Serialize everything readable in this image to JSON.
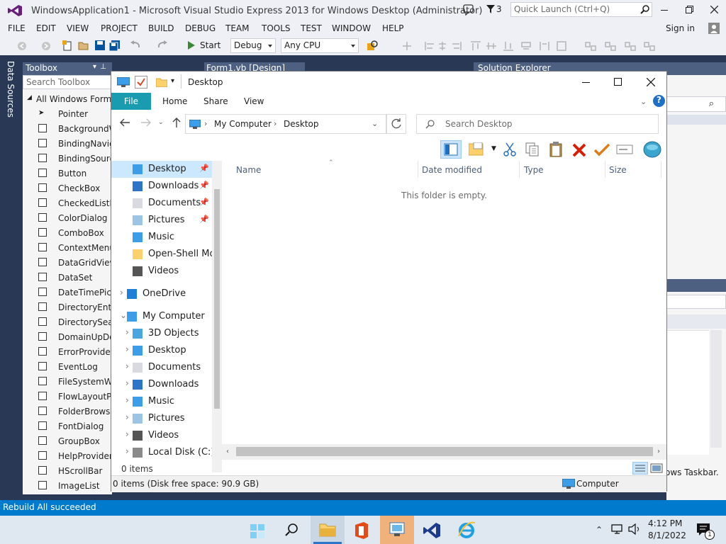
{
  "vs": {
    "title": "WindowsApplication1 - Microsoft Visual Studio Express 2013 for Windows Desktop (Administrator)",
    "notif_count": "3",
    "quick_launch_placeholder": "Quick Launch (Ctrl+Q)",
    "sign_in": "Sign in",
    "menu": [
      "FILE",
      "EDIT",
      "VIEW",
      "PROJECT",
      "BUILD",
      "DEBUG",
      "TEAM",
      "TOOLS",
      "TEST",
      "WINDOW",
      "HELP"
    ],
    "toolbar": {
      "start": "Start",
      "config": "Debug",
      "platform": "Any CPU"
    },
    "data_sources": "Data Sources",
    "toolbox": {
      "title": "Toolbox",
      "search_placeholder": "Search Toolbox",
      "group": "All Windows Forms",
      "items": [
        "Pointer",
        "BackgroundWorker",
        "BindingNavigator",
        "BindingSource",
        "Button",
        "CheckBox",
        "CheckedListBox",
        "ColorDialog",
        "ComboBox",
        "ContextMenuStrip",
        "DataGridView",
        "DataSet",
        "DateTimePicker",
        "DirectoryEntry",
        "DirectorySearcher",
        "DomainUpDown",
        "ErrorProvider",
        "EventLog",
        "FileSystemWatcher",
        "FlowLayoutPanel",
        "FolderBrowserDialog",
        "FontDialog",
        "GroupBox",
        "HelpProvider",
        "HScrollBar",
        "ImageList"
      ]
    },
    "doc_tab": "Form1.vb [Design]",
    "solution_explorer": "Solution Explorer",
    "partial_text": "ows Taskbar.",
    "status": "Rebuild All succeeded"
  },
  "explorer": {
    "title": "Desktop",
    "ribbon_tabs": [
      "File",
      "Home",
      "Share",
      "View"
    ],
    "breadcrumb": [
      "My Computer",
      "Desktop"
    ],
    "search_placeholder": "Search Desktop",
    "quick_access": [
      {
        "label": "Desktop",
        "pinned": true
      },
      {
        "label": "Downloads",
        "pinned": true
      },
      {
        "label": "Documents",
        "pinned": true
      },
      {
        "label": "Pictures",
        "pinned": true
      },
      {
        "label": "Music",
        "pinned": false
      },
      {
        "label": "Open-Shell Mod",
        "pinned": false
      },
      {
        "label": "Videos",
        "pinned": false
      }
    ],
    "onedrive": "OneDrive",
    "my_computer": "My Computer",
    "computer_children": [
      "3D Objects",
      "Desktop",
      "Documents",
      "Downloads",
      "Music",
      "Pictures",
      "Videos",
      "Local Disk (C:)"
    ],
    "columns": [
      "Name",
      "Date modified",
      "Type",
      "Size"
    ],
    "empty_msg": "This folder is empty.",
    "item_count": "0 items",
    "status": "0 items (Disk free space: 90.9 GB)",
    "location": "Computer"
  },
  "taskbar": {
    "time": "4:12 PM",
    "date": "8/1/2022",
    "notif_count": "1"
  }
}
